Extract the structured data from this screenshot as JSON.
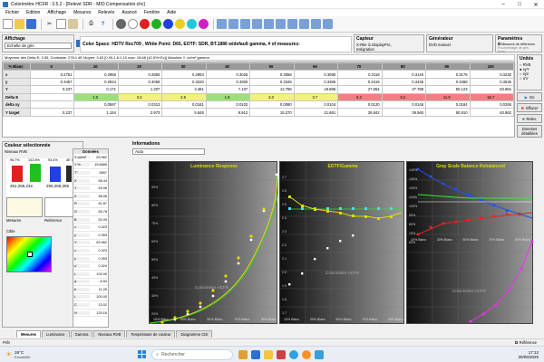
{
  "window": {
    "title": "Colorimètre HCFR : 3.5.2 - [Relevé SDR - MIO Compensation.chc]"
  },
  "menu": [
    "Fichier",
    "Edition",
    "Affichage",
    "Mesures",
    "Relevés",
    "Avancé",
    "Fenêtre",
    "Aide"
  ],
  "affichage": {
    "title": "Affichage",
    "combo": "Echelle de gris"
  },
  "colorspace": "Color Space: HDTV Rec709 , White Point: D65, EOTF: SDR, BT.1886 w/default gamma, # of measures:",
  "capteur": {
    "title": "Capteur",
    "line1": "X-Rite i1 DisplayPro,",
    "line2": "Intégration"
  },
  "generateur": {
    "title": "Générateur",
    "line1": "DVD manuel"
  },
  "parametres": {
    "title": "Paramètres",
    "opt1": "Mesures de référence",
    "opt2": "Pourcentage de gris",
    "opt3": "Auto"
  },
  "stats": "Moyenne des Delta E: 3.55, Contraste: 278:1   dE Moyen: 3.63 [0.00-1.6:1.10 max: 18.68 (42.5%+Ec)]   Absolute Y: cd/m² gamma",
  "table": {
    "headers": [
      "% Blanc",
      "0",
      "10",
      "20",
      "30",
      "40",
      "50",
      "60",
      "70",
      "80",
      "90",
      "100"
    ],
    "rows": [
      {
        "label": "x",
        "cells": [
          "0.2751",
          "0.2956",
          "0.2883",
          "0.2983",
          "0.3026",
          "0.3058",
          "0.3085",
          "0.3119",
          "0.3140",
          "0.3175",
          "0.3230"
        ]
      },
      {
        "label": "y",
        "cells": [
          "0.3457",
          "0.2924",
          "0.3059",
          "0.3220",
          "0.3300",
          "0.3348",
          "0.3385",
          "0.3419",
          "0.3436",
          "0.3468",
          "0.3535"
        ]
      },
      {
        "label": "Y",
        "cells": [
          "0.237",
          "0.171",
          "1.207",
          "3.461",
          "7.107",
          "12.786",
          "18.886",
          "27.654",
          "37.788",
          "50.123",
          "63.962"
        ]
      },
      {
        "label": "Delta E",
        "cells": [
          "",
          "1.0",
          "3.2",
          "2.8",
          "1.8",
          "2.0",
          "3.7",
          "6.2",
          "6.2",
          "11.9",
          "18.7"
        ]
      },
      {
        "label": "delta xy",
        "cells": [
          "",
          "0.0597",
          "0.0313",
          "0.0161",
          "0.0102",
          "0.0080",
          "0.0104",
          "0.0120",
          "0.0146",
          "0.0184",
          "0.0265"
        ]
      },
      {
        "label": "Y target",
        "cells": [
          "0.237",
          "1.154",
          "2.973",
          "5.848",
          "9.912",
          "15.270",
          "21.681",
          "29.842",
          "39.560",
          "50.910",
          "63.962"
        ]
      }
    ]
  },
  "unites": {
    "title": "Unités",
    "opts": [
      "RVB",
      "xyY",
      "xyz",
      "u'v'"
    ]
  },
  "rightbtns": [
    "Go",
    "Effacer",
    "Relev.",
    "Données détaillées"
  ],
  "couleur": {
    "title": "Couleur sélectionnée",
    "niveaux": "Niveaux RVB",
    "bars": [
      {
        "label": "96.7%",
        "color": "#e02020"
      },
      {
        "label": "102.8%",
        "color": "#20c020"
      },
      {
        "label": "93.4%",
        "color": "#2040e0"
      }
    ],
    "dE": "dE 10.7",
    "mesures_val": "251,255,232",
    "mesures_label": "Mesures",
    "reference_val": "255,255,255",
    "reference_label": "Reference",
    "cible": "Cible"
  },
  "donnees": {
    "title": "Données",
    "rows": [
      {
        "k": "Y cd/m²",
        "v": "63.962"
      },
      {
        "k": "Y %",
        "v": "15.6685"
      },
      {
        "k": "T°",
        "v": "5857"
      },
      {
        "k": "X",
        "v": "58.44"
      },
      {
        "k": "Y",
        "v": "63.96"
      },
      {
        "k": "Z",
        "v": "58.56"
      },
      {
        "k": "R",
        "v": "61.87"
      },
      {
        "k": "G",
        "v": "65.78"
      },
      {
        "k": "B",
        "v": "52.09"
      },
      {
        "k": "x",
        "v": "0.323"
      },
      {
        "k": "y",
        "v": "0.353"
      },
      {
        "k": "Y",
        "v": "63.962"
      },
      {
        "k": "x",
        "v": "0.323"
      },
      {
        "k": "y",
        "v": "0.353"
      },
      {
        "k": "u'",
        "v": "0.324"
      },
      {
        "k": "L",
        "v": "100.00"
      },
      {
        "k": "a",
        "v": "-6.54"
      },
      {
        "k": "b",
        "v": "11.25"
      },
      {
        "k": "L",
        "v": "100.00"
      },
      {
        "k": "C",
        "v": "13.02"
      },
      {
        "k": "H",
        "v": "120.16"
      }
    ]
  },
  "informations": {
    "title": "Informations",
    "combo": "Auto"
  },
  "graphs": {
    "luminance": {
      "title": "Luminance Response",
      "footer": [
        "10% Blanc",
        "30% Blanc",
        "50% Blanc",
        "70% Blanc",
        "90% Blanc"
      ],
      "yticks": [
        "90%",
        "80%",
        "70%",
        "60%",
        "50%",
        "40%",
        "30%",
        "20%",
        "10%"
      ]
    },
    "eotf": {
      "title": "EOTF/Gamma",
      "footer": [
        "10% Blanc",
        "30% Blanc",
        "50% Blanc",
        "70% Blanc",
        "90% Blanc"
      ],
      "yticks": [
        "2.7",
        "2.6",
        "2.5",
        "2.4",
        "2.3",
        "2.2",
        "2.1",
        "2.0",
        "1.9",
        "1.8",
        "1.7"
      ]
    },
    "grey": {
      "title": "Gray Scale Balance Rebalanced",
      "footer": [
        "10% Blanc",
        "30% Blanc",
        "50% Blanc",
        "70% Blanc",
        "90% Blanc"
      ],
      "yticks": [
        "140%",
        "130%",
        "120%",
        "110%",
        "100%",
        "90%",
        "80%",
        "70%",
        "60%"
      ]
    },
    "watermark": "Colorimètre HCFR"
  },
  "tabs": [
    "Mesures",
    "Luminance",
    "Gamma",
    "Niveaux RVB",
    "Température de couleur",
    "Diagramme CIE"
  ],
  "status": {
    "ready": "Prêt",
    "reference": "Référence"
  },
  "taskbar": {
    "temp": "26°C",
    "weather": "Ensoleillé",
    "search": "Rechercher",
    "time": "17:12",
    "date": "30/06/2025"
  }
}
